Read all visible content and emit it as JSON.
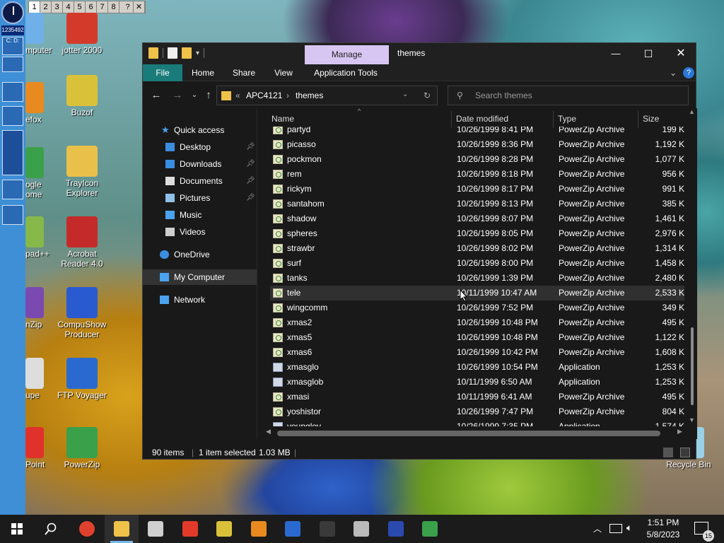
{
  "vdesk": {
    "items": [
      "1",
      "2",
      "3",
      "4",
      "5",
      "6",
      "7",
      "8",
      "?",
      "✕"
    ],
    "selected": "1"
  },
  "strip": {
    "counter": "1235492",
    "cd_label": "C: D:"
  },
  "desktop_icons": [
    {
      "label": "mputer",
      "color": "#6fb0e8"
    },
    {
      "label": "jotter 2000",
      "color": "#d43a2a"
    },
    {
      "label": "efox",
      "color": "#e98a20"
    },
    {
      "label": "Buzof",
      "color": "#d9c23a"
    },
    {
      "label": "ogle\nome",
      "color": "#3aa04a"
    },
    {
      "label": "TrayIcon\nExplorer",
      "color": "#e9c14a"
    },
    {
      "label": "pad++",
      "color": "#86b84a"
    },
    {
      "label": "Acrobat\nReader 4.0",
      "color": "#c42a2a"
    },
    {
      "label": "nZip",
      "color": "#7a4ab0"
    },
    {
      "label": "CompuShow\nProducer",
      "color": "#2a5ad0"
    },
    {
      "label": "upe",
      "color": "#dddddd"
    },
    {
      "label": "FTP Voyager",
      "color": "#2a6ad0"
    },
    {
      "label": "Point",
      "color": "#e0322a"
    },
    {
      "label": "PowerZip",
      "color": "#3aa04a"
    },
    {
      "label": "Recycle Bin",
      "color": "#9ad0e8"
    }
  ],
  "window": {
    "title": "themes",
    "manage_tab": "Manage",
    "ribbon_tabs": [
      "File",
      "Home",
      "Share",
      "View",
      "Application Tools"
    ],
    "address": {
      "chevrons": "«",
      "root": "APC4121",
      "sep": "›",
      "current": "themes"
    },
    "search_placeholder": "Search themes",
    "controls": {
      "min": "—",
      "max": "☐",
      "close": "✕"
    }
  },
  "nav": {
    "quick_access": "Quick access",
    "items": [
      "Desktop",
      "Downloads",
      "Documents",
      "Pictures",
      "Music",
      "Videos"
    ],
    "onedrive": "OneDrive",
    "mycomputer": "My Computer",
    "network": "Network"
  },
  "columns": {
    "name": "Name",
    "date": "Date modified",
    "type": "Type",
    "size": "Size"
  },
  "files": [
    {
      "name": "partyd",
      "date": "10/26/1999 8:41 PM",
      "type": "PowerZip Archive",
      "size": "199 K",
      "kind": "zip"
    },
    {
      "name": "picasso",
      "date": "10/26/1999 8:36 PM",
      "type": "PowerZip Archive",
      "size": "1,192 K",
      "kind": "zip"
    },
    {
      "name": "pockmon",
      "date": "10/26/1999 8:28 PM",
      "type": "PowerZip Archive",
      "size": "1,077 K",
      "kind": "zip"
    },
    {
      "name": "rem",
      "date": "10/26/1999 8:18 PM",
      "type": "PowerZip Archive",
      "size": "956 K",
      "kind": "zip"
    },
    {
      "name": "rickym",
      "date": "10/26/1999 8:17 PM",
      "type": "PowerZip Archive",
      "size": "991 K",
      "kind": "zip"
    },
    {
      "name": "santahom",
      "date": "10/26/1999 8:13 PM",
      "type": "PowerZip Archive",
      "size": "385 K",
      "kind": "zip"
    },
    {
      "name": "shadow",
      "date": "10/26/1999 8:07 PM",
      "type": "PowerZip Archive",
      "size": "1,461 K",
      "kind": "zip"
    },
    {
      "name": "spheres",
      "date": "10/26/1999 8:05 PM",
      "type": "PowerZip Archive",
      "size": "2,976 K",
      "kind": "zip"
    },
    {
      "name": "strawbr",
      "date": "10/26/1999 8:02 PM",
      "type": "PowerZip Archive",
      "size": "1,314 K",
      "kind": "zip"
    },
    {
      "name": "surf",
      "date": "10/26/1999 8:00 PM",
      "type": "PowerZip Archive",
      "size": "1,458 K",
      "kind": "zip"
    },
    {
      "name": "tanks",
      "date": "10/26/1999 1:39 PM",
      "type": "PowerZip Archive",
      "size": "2,480 K",
      "kind": "zip"
    },
    {
      "name": "tele",
      "date": "10/11/1999 10:47 AM",
      "type": "PowerZip Archive",
      "size": "2,533 K",
      "kind": "zip",
      "selected": true
    },
    {
      "name": "wingcomm",
      "date": "10/26/1999 7:52 PM",
      "type": "PowerZip Archive",
      "size": "349 K",
      "kind": "zip"
    },
    {
      "name": "xmas2",
      "date": "10/26/1999 10:48 PM",
      "type": "PowerZip Archive",
      "size": "495 K",
      "kind": "zip"
    },
    {
      "name": "xmas5",
      "date": "10/26/1999 10:48 PM",
      "type": "PowerZip Archive",
      "size": "1,122 K",
      "kind": "zip"
    },
    {
      "name": "xmas6",
      "date": "10/26/1999 10:42 PM",
      "type": "PowerZip Archive",
      "size": "1,608 K",
      "kind": "zip"
    },
    {
      "name": "xmasglo",
      "date": "10/26/1999 10:54 PM",
      "type": "Application",
      "size": "1,253 K",
      "kind": "app"
    },
    {
      "name": "xmasglob",
      "date": "10/11/1999 6:50 AM",
      "type": "Application",
      "size": "1,253 K",
      "kind": "app"
    },
    {
      "name": "xmasi",
      "date": "10/11/1999 6:41 AM",
      "type": "PowerZip Archive",
      "size": "495 K",
      "kind": "zip"
    },
    {
      "name": "yoshistor",
      "date": "10/26/1999 7:47 PM",
      "type": "PowerZip Archive",
      "size": "804 K",
      "kind": "zip"
    },
    {
      "name": "younglov",
      "date": "10/26/1999 7:35 PM",
      "type": "Application",
      "size": "1,574 K",
      "kind": "app"
    }
  ],
  "status": {
    "count": "90 items",
    "selected": "1 item selected",
    "size": "1.03 MB"
  },
  "taskbar": {
    "apps": [
      {
        "name": "chrome",
        "color": "#e0412f"
      },
      {
        "name": "file-explorer",
        "color": "#f0c24a",
        "active": true
      },
      {
        "name": "satellite-app",
        "color": "#cfcfcf"
      },
      {
        "name": "rocket-app",
        "color": "#e23a2a"
      },
      {
        "name": "buzof",
        "color": "#d9c23a"
      },
      {
        "name": "firefox",
        "color": "#e98a20"
      },
      {
        "name": "ftp-voyager",
        "color": "#2a6ad0"
      },
      {
        "name": "console",
        "color": "#3a3a3a"
      },
      {
        "name": "tools-app",
        "color": "#bbbbbb"
      },
      {
        "name": "star-app",
        "color": "#2a4ab0"
      },
      {
        "name": "powerzip",
        "color": "#3aa04a"
      }
    ],
    "time": "1:51 PM",
    "date": "5/8/2023",
    "notif_count": "15"
  }
}
